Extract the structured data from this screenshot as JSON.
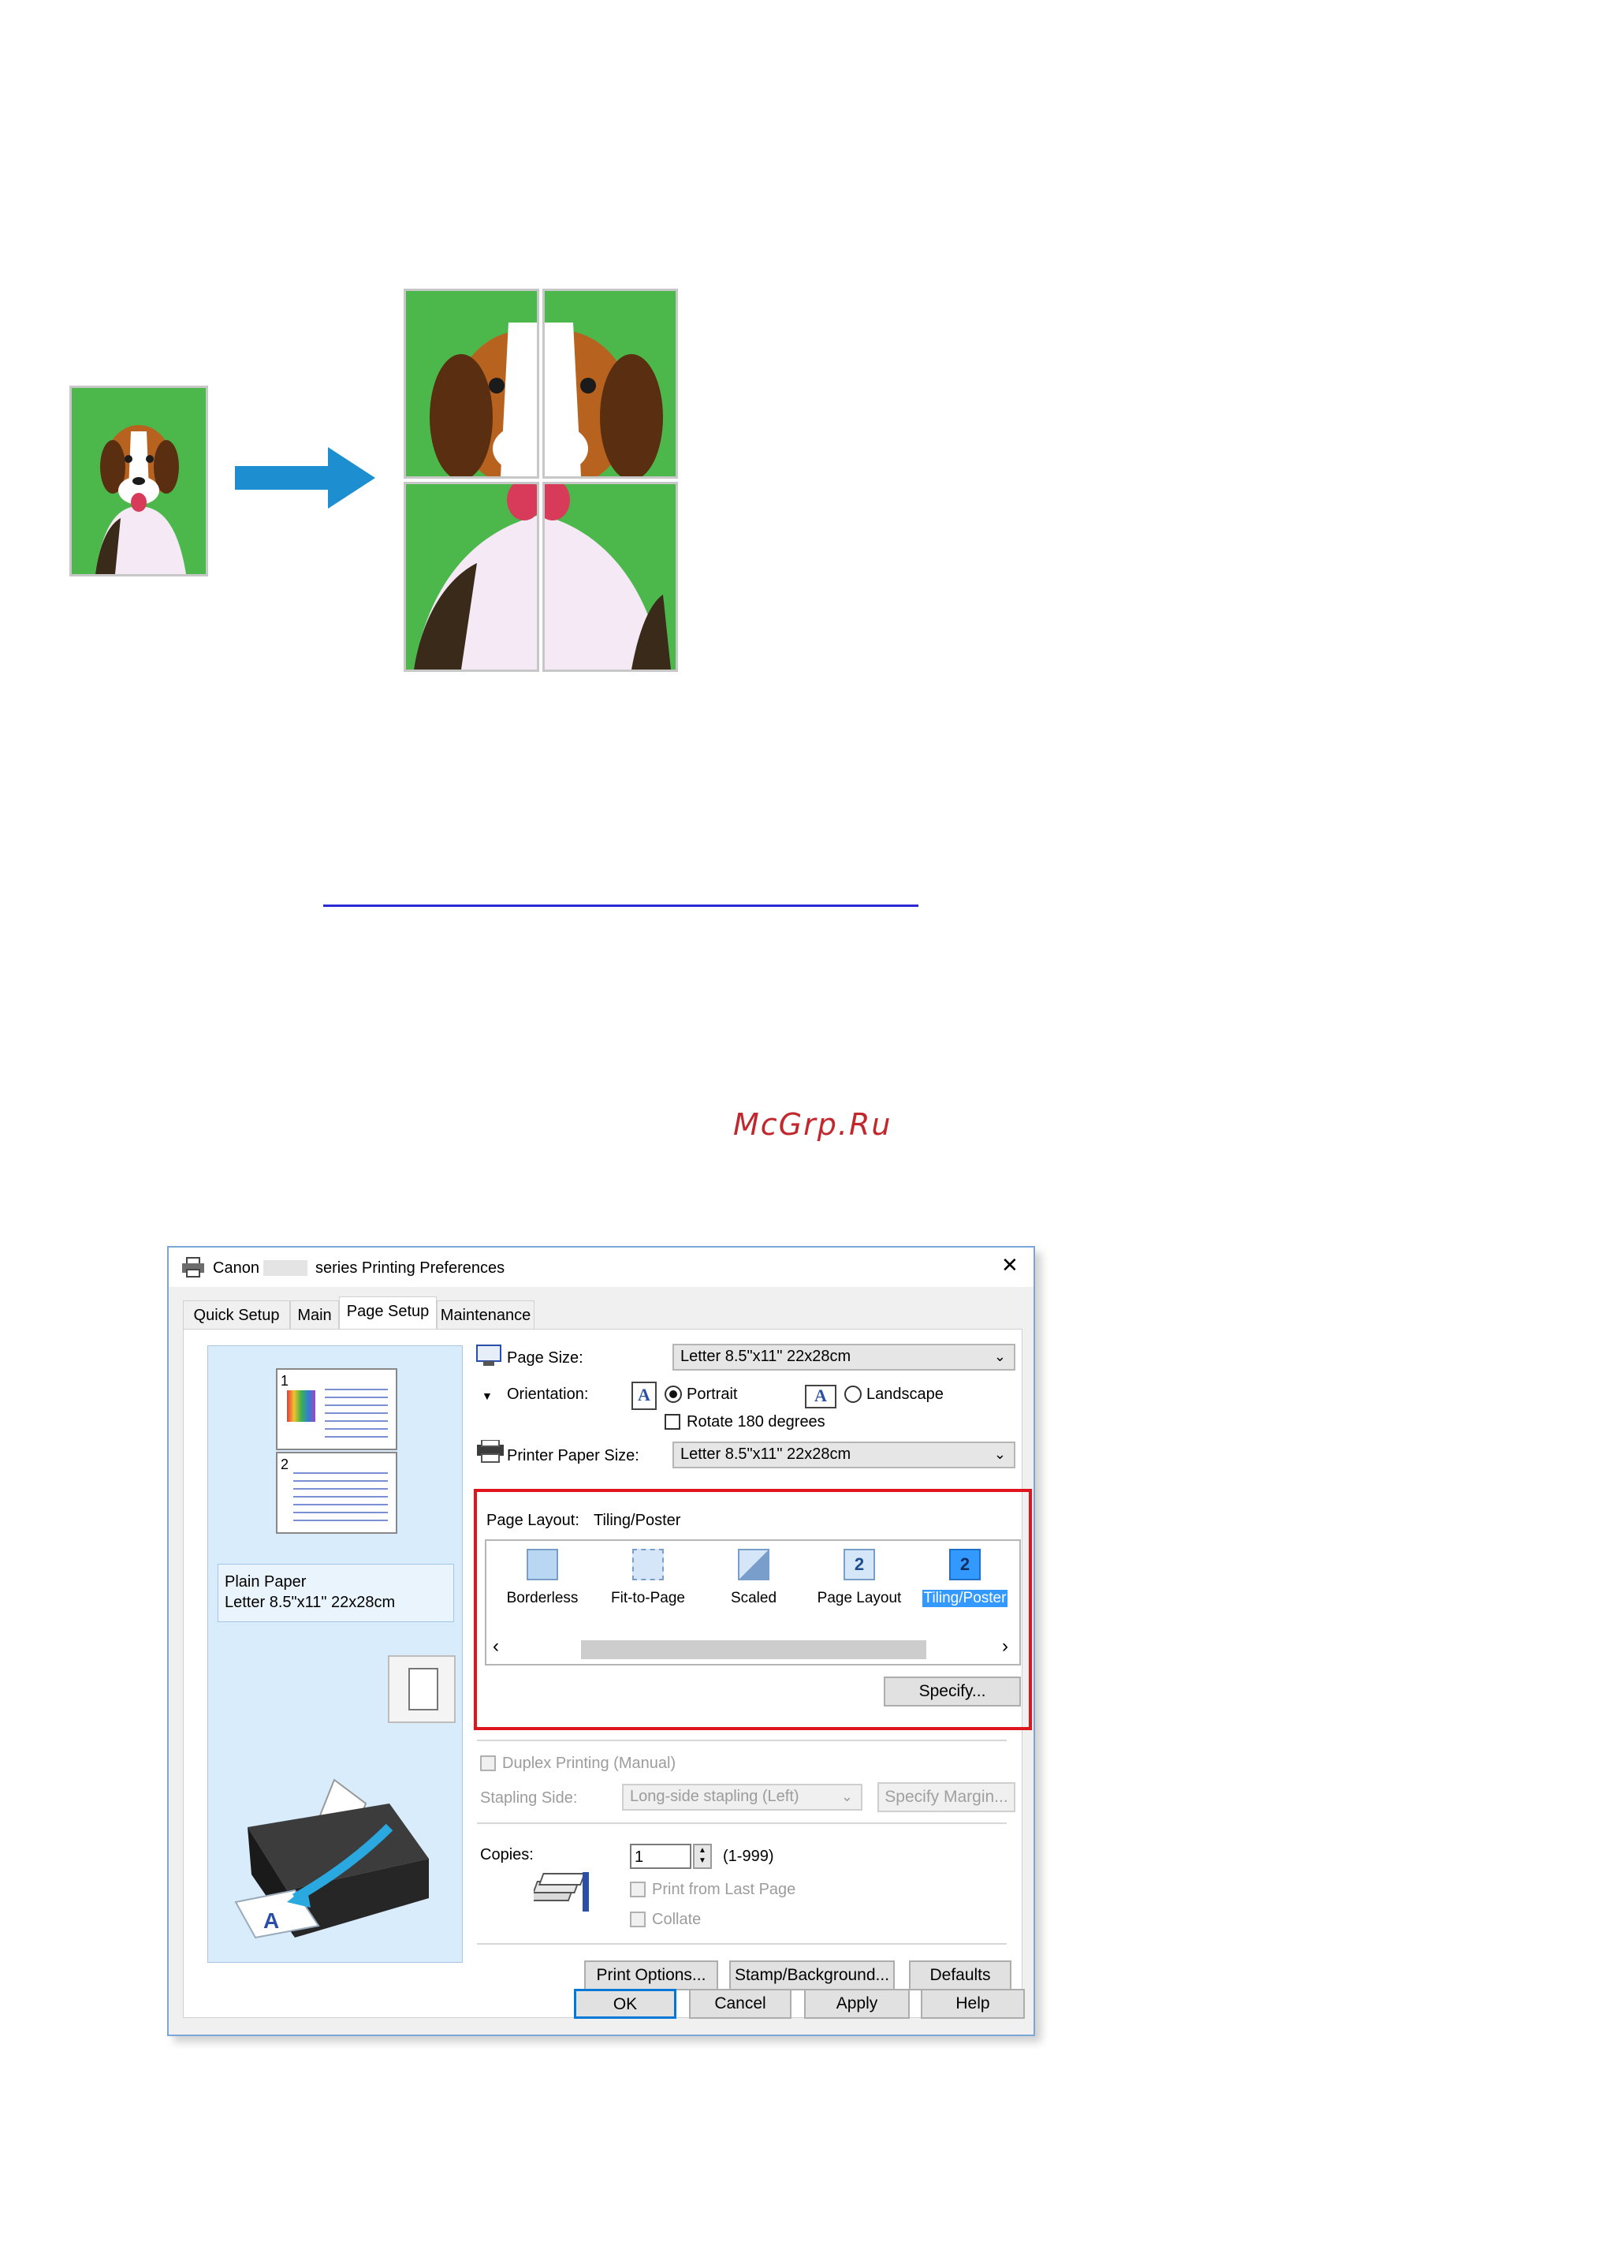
{
  "watermark": "McGrp.Ru",
  "dialog": {
    "title_prefix": "Canon",
    "title_suffix": "series Printing Preferences",
    "close_glyph": "✕",
    "tabs": [
      "Quick Setup",
      "Main",
      "Page Setup",
      "Maintenance"
    ],
    "active_tab": "Page Setup",
    "preview": {
      "page1_number": "1",
      "page2_number": "2",
      "media_type": "Plain Paper",
      "media_size": "Letter 8.5\"x11\" 22x28cm"
    },
    "page_size": {
      "label": "Page Size:",
      "value": "Letter 8.5\"x11\" 22x28cm"
    },
    "orientation": {
      "label": "Orientation:",
      "portrait": "Portrait",
      "landscape": "Landscape",
      "selected": "Portrait",
      "icon_letter": "A"
    },
    "rotate_180": {
      "label": "Rotate 180 degrees",
      "checked": false
    },
    "printer_paper_size": {
      "label": "Printer Paper Size:",
      "value": "Letter 8.5\"x11\" 22x28cm"
    },
    "page_layout": {
      "label": "Page Layout:",
      "value": "Tiling/Poster",
      "items": [
        "Borderless",
        "Fit-to-Page",
        "Scaled",
        "Page Layout",
        "Tiling/Poster"
      ],
      "selected": "Tiling/Poster",
      "page_layout_icon_number": "2",
      "tiling_icon_number": "2",
      "scroll_left": "‹",
      "scroll_right": "›",
      "specify_button": "Specify..."
    },
    "duplex": {
      "label": "Duplex Printing (Manual)",
      "enabled": false
    },
    "stapling": {
      "label": "Stapling Side:",
      "value": "Long-side stapling (Left)",
      "margin_button": "Specify Margin..."
    },
    "copies": {
      "label": "Copies:",
      "value": "1",
      "range": "(1-999)",
      "print_from_last": "Print from Last Page",
      "collate": "Collate"
    },
    "buttons": {
      "print_options": "Print Options...",
      "stamp_background": "Stamp/Background...",
      "defaults": "Defaults",
      "ok": "OK",
      "cancel": "Cancel",
      "apply": "Apply",
      "help": "Help"
    },
    "colors": {
      "highlight_frame": "#e0141c",
      "selection": "#3399ff",
      "preview_bg": "#d9ecfb"
    }
  }
}
